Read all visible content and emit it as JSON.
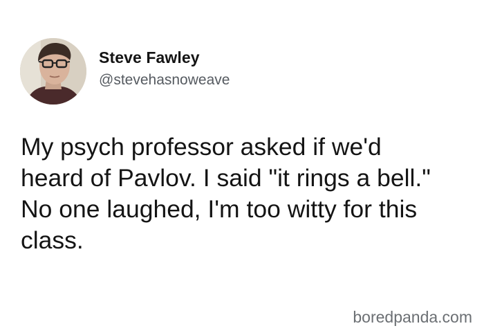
{
  "author": {
    "display_name": "Steve Fawley",
    "handle": "@stevehasnoweave",
    "avatar": "profile-photo"
  },
  "tweet": {
    "lines": [
      "My psych professor asked if we'd",
      "heard of Pavlov. I said \"it rings a bell.\"",
      "No one laughed, I'm too witty for this",
      "class."
    ]
  },
  "watermark": {
    "text": "boredpanda.com"
  },
  "colors": {
    "background": "#ffffff",
    "text": "#141414",
    "handle": "#555a60",
    "watermark": "#6b6f73"
  }
}
